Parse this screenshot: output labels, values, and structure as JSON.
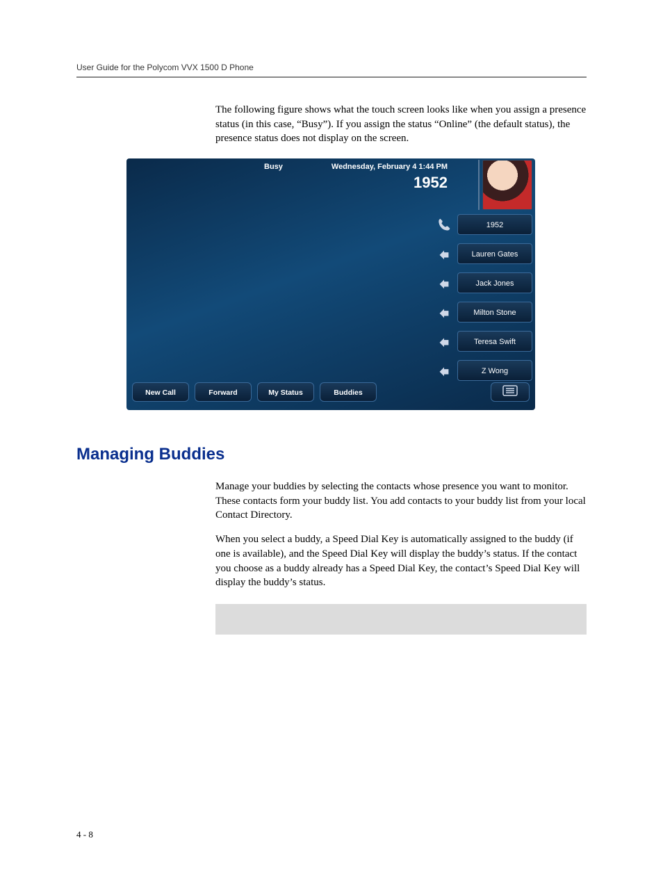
{
  "header": {
    "running_head": "User Guide for the Polycom VVX 1500 D Phone"
  },
  "intro_para": "The following figure shows what the touch screen looks like when you assign a presence status (in this case, “Busy”). If you assign the status “Online” (the default status), the presence status does not display on the screen.",
  "phone": {
    "status": "Busy",
    "datetime": "Wednesday, February 4  1:44 PM",
    "extension": "1952",
    "speed_dials": [
      {
        "label": "1952",
        "icon": "handset"
      },
      {
        "label": "Lauren Gates",
        "icon": "buddy"
      },
      {
        "label": "Jack Jones",
        "icon": "buddy"
      },
      {
        "label": "Milton Stone",
        "icon": "buddy"
      },
      {
        "label": "Teresa Swift",
        "icon": "buddy"
      },
      {
        "label": "Z Wong",
        "icon": "buddy"
      }
    ],
    "softkeys": [
      "New Call",
      "Forward",
      "My Status",
      "Buddies"
    ]
  },
  "section": {
    "heading": "Managing Buddies",
    "p1": "Manage your buddies by selecting the contacts whose presence you want to monitor. These contacts form your buddy list. You add contacts to your buddy list from your local Contact Directory.",
    "p2": "When you select a buddy, a Speed Dial Key is automatically assigned to the buddy (if one is available), and the Speed Dial Key will display the buddy’s status. If the contact you choose as a buddy already has a Speed Dial Key, the contact’s Speed Dial Key will display the buddy’s status."
  },
  "page_number": "4 - 8"
}
